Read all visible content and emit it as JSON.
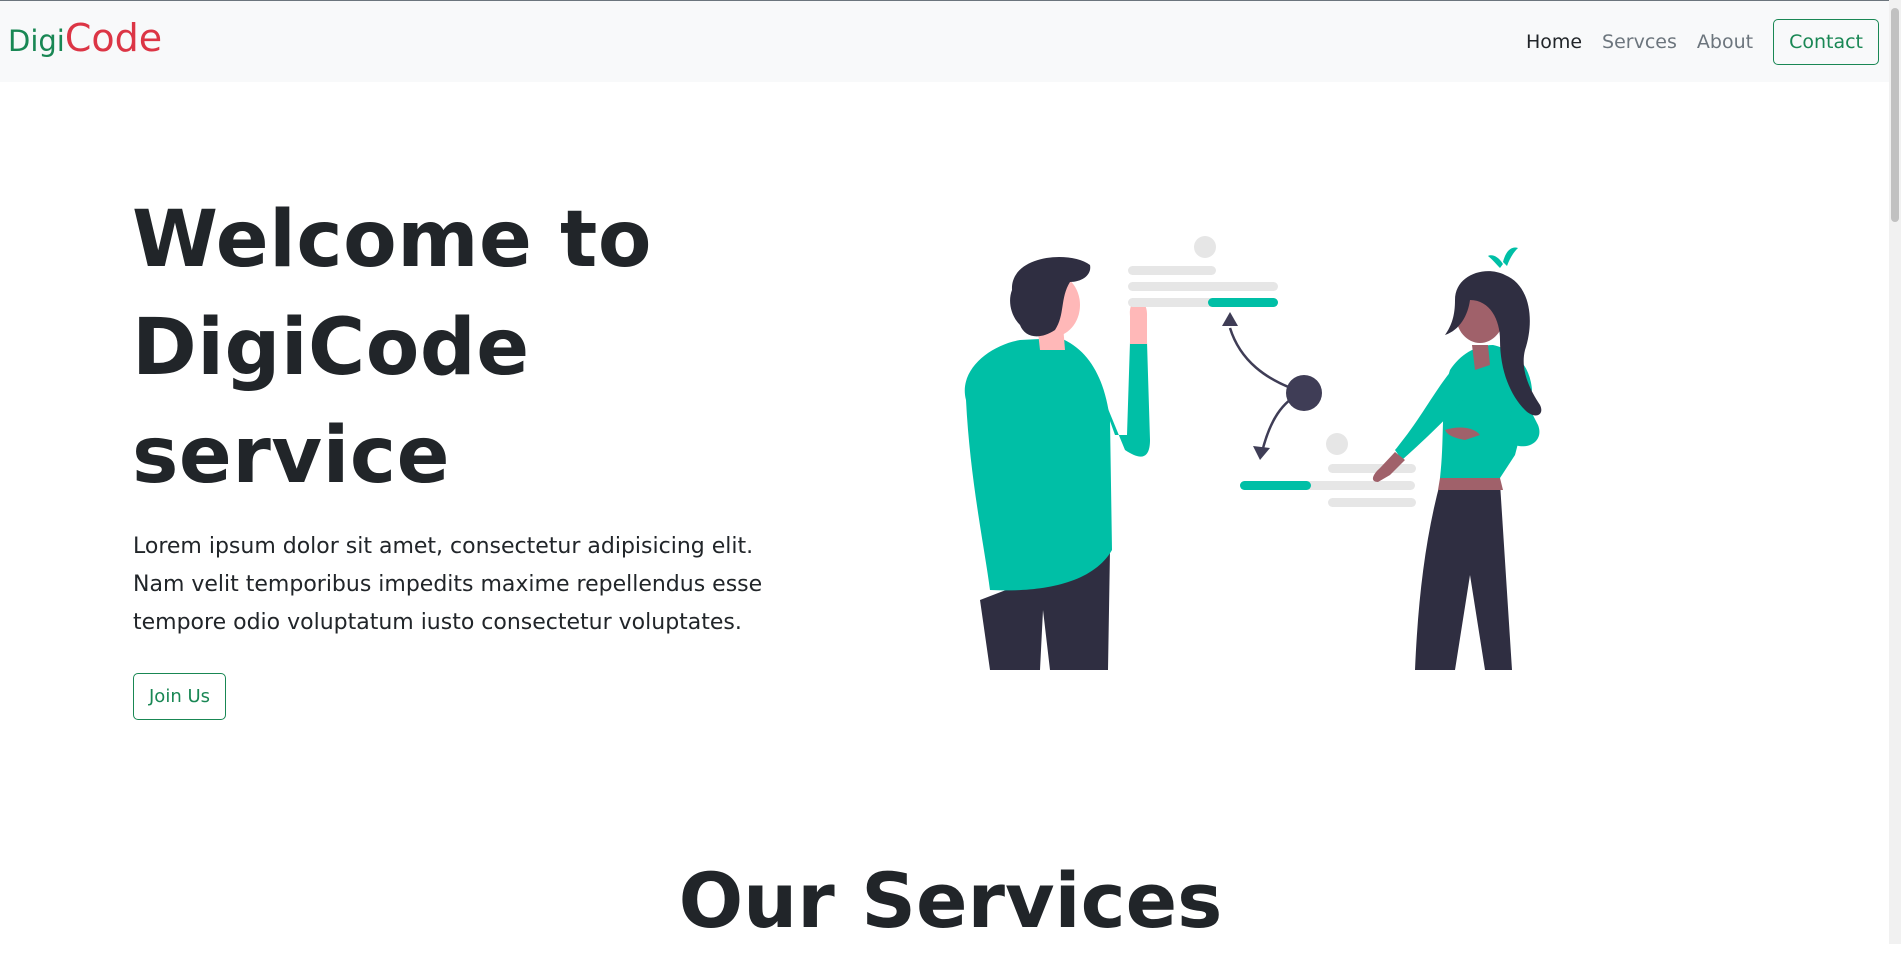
{
  "navbar": {
    "brand_first": "Digi",
    "brand_second": "Code",
    "links": [
      "Home",
      "Servces",
      "About"
    ],
    "contact": "Contact"
  },
  "hero": {
    "title": "Welcome to DigiCode service",
    "text": "Lorem ipsum dolor sit amet, consectetur adipisicing elit. Nam velit temporibus impedits maxime repellendus esse tempore odio voluptatum iusto consectetur voluptates.",
    "button": "Join Us"
  },
  "services": {
    "title": "Our Services"
  },
  "colors": {
    "brand_green": "#198754",
    "brand_red": "#dc3545",
    "illustration_teal": "#00bfa6",
    "illustration_dark": "#2f2e41"
  }
}
